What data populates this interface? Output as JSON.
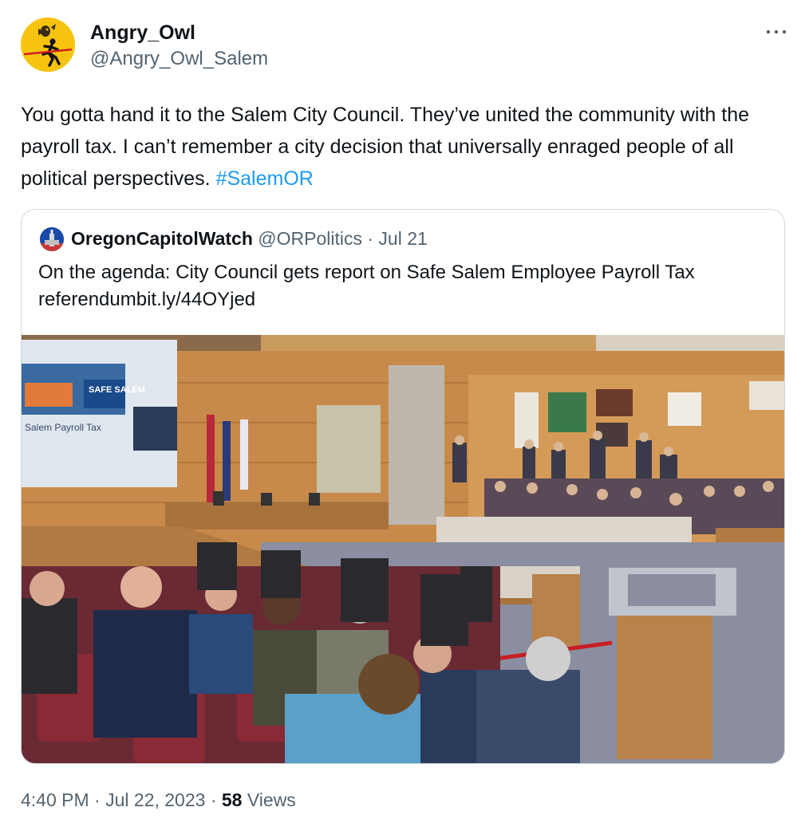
{
  "author": {
    "display_name": "Angry_Owl",
    "handle": "@Angry_Owl_Salem"
  },
  "tweet": {
    "text": "You gotta hand it to the Salem City Council. They’ve united the community with the payroll tax. I can’t remember a city decision that universally enraged people of all political perspectives. ",
    "hashtag": "#SalemOR"
  },
  "quote": {
    "display_name": "OregonCapitolWatch",
    "handle": "@ORPolitics",
    "separator": " · ",
    "date": "Jul 21",
    "text_line1": "On the agenda: City Council gets report on Safe Salem Employee Payroll Tax",
    "text_line2": "referendumbit.ly/44OYjed",
    "photo": {
      "slide_logo": "SAFE SALEM",
      "slide_title": "Salem Payroll Tax"
    }
  },
  "footer": {
    "time": "4:40 PM",
    "sep1": " · ",
    "date": "Jul 22, 2023",
    "sep2": " · ",
    "views_count": "58",
    "views_label": " Views"
  },
  "colors": {
    "link": "#1d9bf0",
    "secondary_text": "#536471",
    "border": "#cfd9de",
    "avatar_bg": "#f6c40f"
  },
  "icons": {
    "more": "more-icon",
    "avatar": "owl-runner-avatar"
  }
}
